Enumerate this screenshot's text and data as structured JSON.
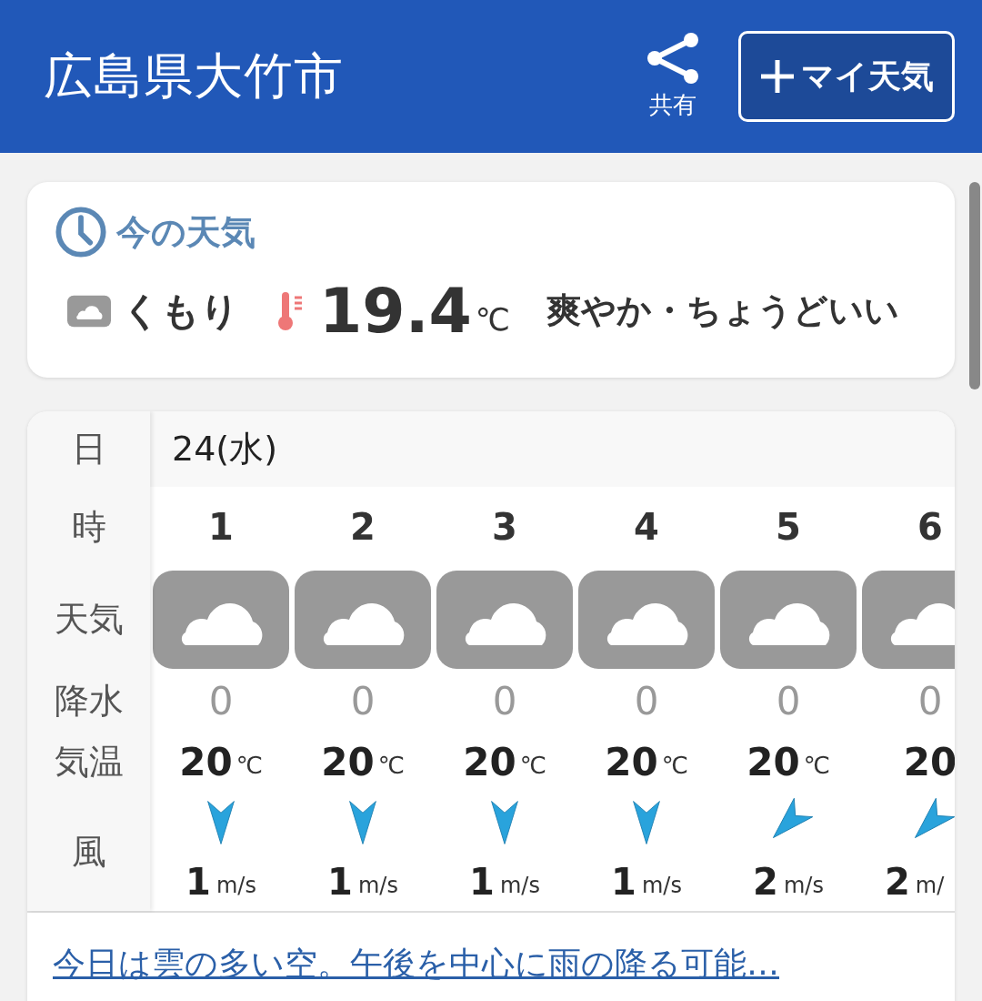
{
  "header": {
    "title": "広島県大竹市",
    "share_label": "共有",
    "my_weather_button": "マイ天気"
  },
  "current": {
    "heading": "今の天気",
    "weather": {
      "kind": "cloudy"
    },
    "condition": "くもり",
    "temperature": "19.4",
    "unit": "℃",
    "feel": "爽やか・ちょうどいい"
  },
  "forecast": {
    "row_labels": {
      "date": "日",
      "hour": "時",
      "weather": "天気",
      "precip": "降水",
      "temp": "気温",
      "wind": "風"
    },
    "date": "24(水)",
    "hours": [
      {
        "hour": "1",
        "weather": {
          "kind": "cloudy"
        },
        "precip": "0",
        "temp": "20",
        "temp_unit": "℃",
        "wind": {
          "kind": "north",
          "speed": "1",
          "unit": "m/s"
        }
      },
      {
        "hour": "2",
        "weather": {
          "kind": "cloudy"
        },
        "precip": "0",
        "temp": "20",
        "temp_unit": "℃",
        "wind": {
          "kind": "north",
          "speed": "1",
          "unit": "m/s"
        }
      },
      {
        "hour": "3",
        "weather": {
          "kind": "cloudy"
        },
        "precip": "0",
        "temp": "20",
        "temp_unit": "℃",
        "wind": {
          "kind": "north",
          "speed": "1",
          "unit": "m/s"
        }
      },
      {
        "hour": "4",
        "weather": {
          "kind": "cloudy"
        },
        "precip": "0",
        "temp": "20",
        "temp_unit": "℃",
        "wind": {
          "kind": "north",
          "speed": "1",
          "unit": "m/s"
        }
      },
      {
        "hour": "5",
        "weather": {
          "kind": "cloudy"
        },
        "precip": "0",
        "temp": "20",
        "temp_unit": "℃",
        "wind": {
          "kind": "northeast",
          "speed": "2",
          "unit": "m/s"
        }
      },
      {
        "hour": "6",
        "weather": {
          "kind": "cloudy"
        },
        "precip": "0",
        "temp": "20",
        "wind": {
          "kind": "northeast",
          "speed": "2",
          "unit": "m/"
        }
      }
    ]
  },
  "summary_link": "今日は雲の多い空。午後を中心に雨の降る可能…"
}
